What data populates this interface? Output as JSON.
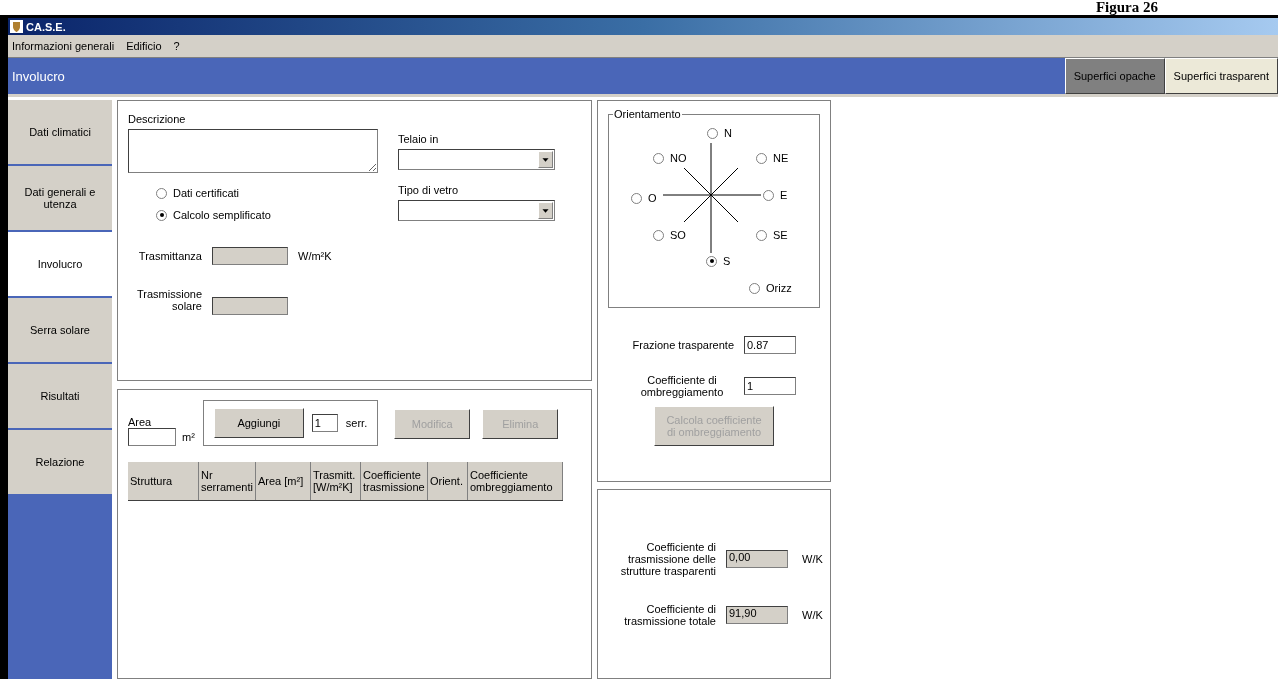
{
  "caption": "Figura 26",
  "window": {
    "title": "CA.S.E."
  },
  "menu": [
    "Informazioni generali",
    "Edificio",
    "?"
  ],
  "header": {
    "title": "Involucro",
    "tabs": [
      {
        "label": "Superfici opache",
        "selected": false
      },
      {
        "label": "Superfici trasparent",
        "selected": true
      }
    ]
  },
  "sidebar": {
    "items": [
      {
        "label": "Dati climatici",
        "selected": false
      },
      {
        "label": "Dati generali e utenza",
        "selected": false
      },
      {
        "label": "Involucro",
        "selected": true
      },
      {
        "label": "Serra solare",
        "selected": false
      },
      {
        "label": "Risultati",
        "selected": false
      },
      {
        "label": "Relazione",
        "selected": false
      }
    ]
  },
  "form": {
    "description_label": "Descrizione",
    "frame_label": "Telaio in",
    "glass_label": "Tipo di vetro",
    "methods": [
      {
        "label": "Dati certificati",
        "selected": false
      },
      {
        "label": "Calcolo semplificato",
        "selected": true
      }
    ],
    "transmittance": {
      "label": "Trasmittanza",
      "unit": "W/m²K"
    },
    "solar": {
      "label": "Trasmissione solare"
    }
  },
  "area": {
    "label": "Area",
    "unit": "m²",
    "add_button": "Aggiungi",
    "count": "1",
    "count_unit": "serr.",
    "buttons": [
      {
        "label": "Modifica",
        "disabled": true
      },
      {
        "label": "Elimina",
        "disabled": true
      }
    ]
  },
  "table": {
    "columns": [
      "Struttura",
      "Nr serramenti",
      "Area [m²]",
      "Trasmitt. [W/m²K]",
      "Coefficiente trasmissione",
      "Orient.",
      "Coefficiente ombreggiamento"
    ]
  },
  "orientation": {
    "title": "Orientamento",
    "options": [
      {
        "label": "N",
        "selected": false
      },
      {
        "label": "NO",
        "selected": false
      },
      {
        "label": "NE",
        "selected": false
      },
      {
        "label": "O",
        "selected": false
      },
      {
        "label": "E",
        "selected": false
      },
      {
        "label": "SO",
        "selected": false
      },
      {
        "label": "SE",
        "selected": false
      },
      {
        "label": "S",
        "selected": true
      },
      {
        "label": "Orizz",
        "selected": false
      }
    ]
  },
  "fraction": {
    "label": "Frazione trasparente",
    "value": "0.87"
  },
  "shading": {
    "label": "Coefficiente di ombreggiamento",
    "value": "1",
    "button": {
      "label": "Calcola coefficiente di ombreggiamento",
      "disabled": true
    }
  },
  "results": [
    {
      "label": "Coefficiente di trasmissione delle strutture trasparenti",
      "value": "0,00",
      "unit": "W/K"
    },
    {
      "label": "Coefficiente di trasmissione totale",
      "value": "91,90",
      "unit": "W/K"
    }
  ]
}
